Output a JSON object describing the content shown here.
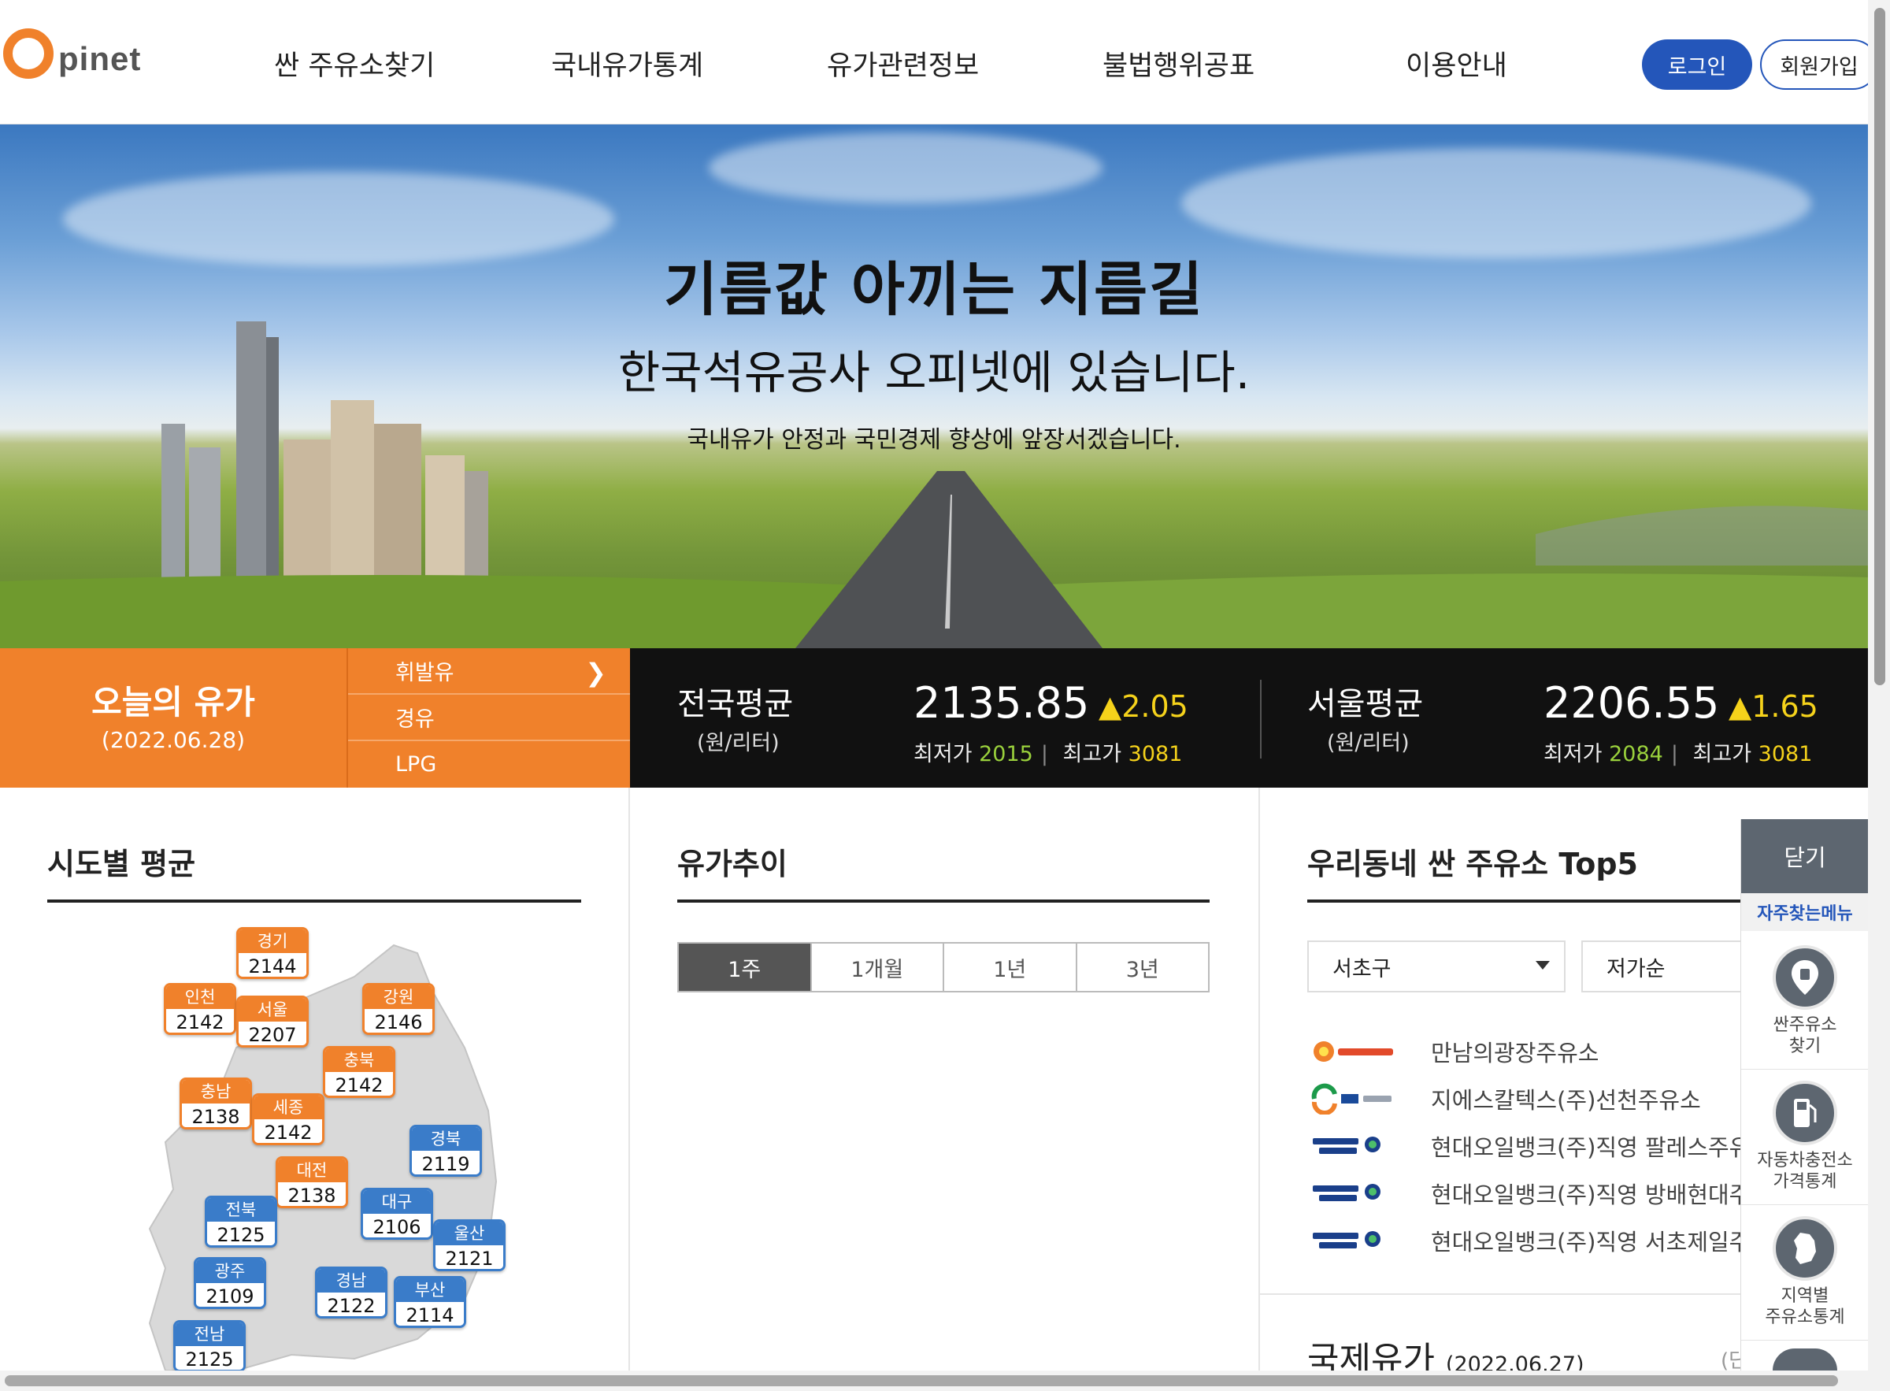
{
  "header": {
    "logo_text": "pinet",
    "nav": [
      "싼 주유소찾기",
      "국내유가통계",
      "유가관련정보",
      "불법행위공표",
      "이용안내"
    ],
    "login": "로그인",
    "join": "회원가입"
  },
  "hero": {
    "title": "기름값 아끼는 지름길",
    "subtitle": "한국석유공사 오피넷에 있습니다.",
    "tagline": "국내유가 안정과 국민경제 향상에 앞장서겠습니다."
  },
  "today_price": {
    "title": "오늘의 유가",
    "date": "(2022.06.28)",
    "fuel_tabs": [
      "휘발유",
      "경유",
      "LPG"
    ],
    "active_fuel": "휘발유",
    "national": {
      "label": "전국평균",
      "unit": "(원/리터)",
      "value": "2135.85",
      "change": "▲2.05",
      "min_label": "최저가",
      "min": "2015",
      "max_label": "최고가",
      "max": "3081"
    },
    "seoul": {
      "label": "서울평균",
      "unit": "(원/리터)",
      "value": "2206.55",
      "change": "▲1.65",
      "min_label": "최저가",
      "min": "2084",
      "max_label": "최고가",
      "max": "3081"
    },
    "colors": {
      "orange": "#f0812b",
      "low": "#9ad13c",
      "high": "#f5d21b"
    }
  },
  "regional": {
    "title": "시도별 평균",
    "regions": [
      {
        "name": "경기",
        "value": "2144",
        "color": "orange"
      },
      {
        "name": "인천",
        "value": "2142",
        "color": "orange"
      },
      {
        "name": "서울",
        "value": "2207",
        "color": "orange"
      },
      {
        "name": "강원",
        "value": "2146",
        "color": "orange"
      },
      {
        "name": "충북",
        "value": "2142",
        "color": "orange"
      },
      {
        "name": "충남",
        "value": "2138",
        "color": "orange"
      },
      {
        "name": "세종",
        "value": "2142",
        "color": "orange"
      },
      {
        "name": "경북",
        "value": "2119",
        "color": "blue"
      },
      {
        "name": "대전",
        "value": "2138",
        "color": "orange"
      },
      {
        "name": "전북",
        "value": "2125",
        "color": "blue"
      },
      {
        "name": "대구",
        "value": "2106",
        "color": "blue"
      },
      {
        "name": "울산",
        "value": "2121",
        "color": "blue"
      },
      {
        "name": "광주",
        "value": "2109",
        "color": "blue"
      },
      {
        "name": "경남",
        "value": "2122",
        "color": "blue"
      },
      {
        "name": "부산",
        "value": "2114",
        "color": "blue"
      },
      {
        "name": "전남",
        "value": "2125",
        "color": "blue"
      }
    ]
  },
  "trend": {
    "title": "유가추이",
    "periods": [
      "1주",
      "1개월",
      "1년",
      "3년"
    ],
    "active_period": "1주"
  },
  "top5": {
    "title": "우리동네 싼 주유소 Top5",
    "district": "서초구",
    "sort": "저가순",
    "stations": [
      {
        "brand": "알뜰주유소",
        "name": "만남의광장주유소"
      },
      {
        "brand": "GS칼텍스",
        "name": "지에스칼텍스(주)선천주유소"
      },
      {
        "brand": "Hyundai Oilbank",
        "name": "현대오일뱅크(주)직영 팔레스주유소"
      },
      {
        "brand": "Hyundai Oilbank",
        "name": "현대오일뱅크(주)직영 방배현대주유소"
      },
      {
        "brand": "Hyundai Oilbank",
        "name": "현대오일뱅크(주)직영 서초제일주유소"
      }
    ]
  },
  "international": {
    "title": "국제유가",
    "date": "(2022.06.27)",
    "unit": "(단"
  },
  "quick_menu": {
    "close": "닫기",
    "title": "자주찾는메뉴",
    "items": [
      {
        "label": "싼주유소\n찾기",
        "icon": "location-pin-icon"
      },
      {
        "label": "자동차충전소\n가격통계",
        "icon": "fuel-pump-icon"
      },
      {
        "label": "지역별\n주유소통계",
        "icon": "korea-map-icon"
      }
    ]
  }
}
